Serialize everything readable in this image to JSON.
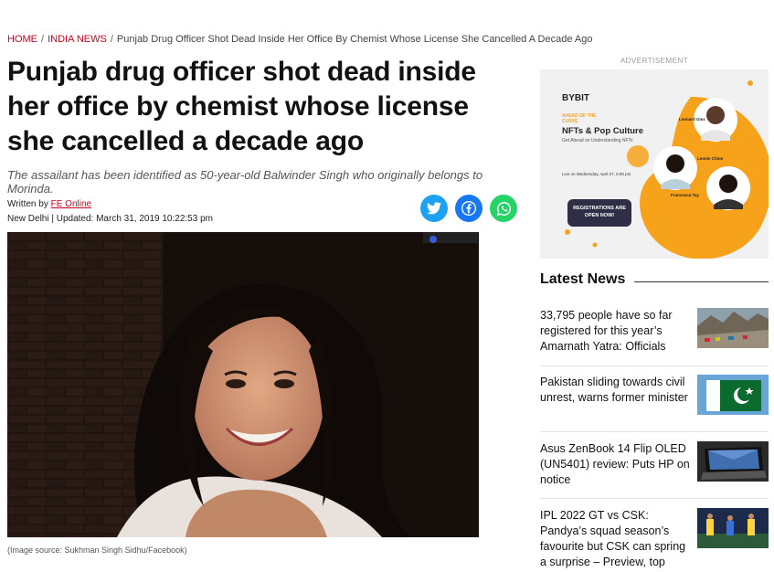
{
  "breadcrumb": {
    "home": "HOME",
    "section": "INDIA NEWS",
    "separator": "/",
    "current": "Punjab Drug Officer Shot Dead Inside Her Office By Chemist Whose License She Cancelled A Decade Ago"
  },
  "article": {
    "headline": "Punjab drug officer shot dead inside her office by chemist whose license she cancelled a decade ago",
    "summary": "The assailant has been identified as 50-year-old Balwinder Singh who originally belongs to Morinda.",
    "written_by_label": "Written by",
    "author": "FE Online",
    "location": "New Delhi",
    "updated": "Updated: March 31, 2019 10:22:53 pm",
    "image_caption": "(Image source: Sukhman Singh Sidhu/Facebook)"
  },
  "share": {
    "twitter_icon": "twitter-icon",
    "facebook_icon": "facebook-icon",
    "whatsapp_icon": "whatsapp-icon"
  },
  "sidebar": {
    "ad_label": "ADVERTISEMENT",
    "ad": {
      "brand": "BYBIT",
      "tag": "AHEAD OF THE CURVE",
      "title": "NFTs & Pop Culture",
      "subtitle": "Get Ahead on Understanding NFTs",
      "date": "Live on Wednesday, April 27, 5:00 pm",
      "cta": "REGISTRATIONS ARE OPEN NOW!",
      "speaker1": "Leonard Giss",
      "speaker2": "Leonie Chloe",
      "speaker3": "Francesca Tay"
    },
    "latest_news_title": "Latest News",
    "latest_news": [
      {
        "title": "33,795 people have so far registered for this year’s Amarnath Yatra: Officials"
      },
      {
        "title": "Pakistan sliding towards civil unrest, warns former minister"
      },
      {
        "title": "Asus ZenBook 14 Flip OLED (UN5401) review: Puts HP on notice"
      },
      {
        "title": "IPL 2022 GT vs CSK: Pandya’s squad season’s favourite but CSK can spring a surprise – Preview, top"
      }
    ]
  },
  "colors": {
    "accent_red": "#d0021b",
    "twitter": "#1da1f2",
    "facebook": "#1877f2",
    "whatsapp": "#25d366",
    "ad_orange": "#f7a21b"
  }
}
